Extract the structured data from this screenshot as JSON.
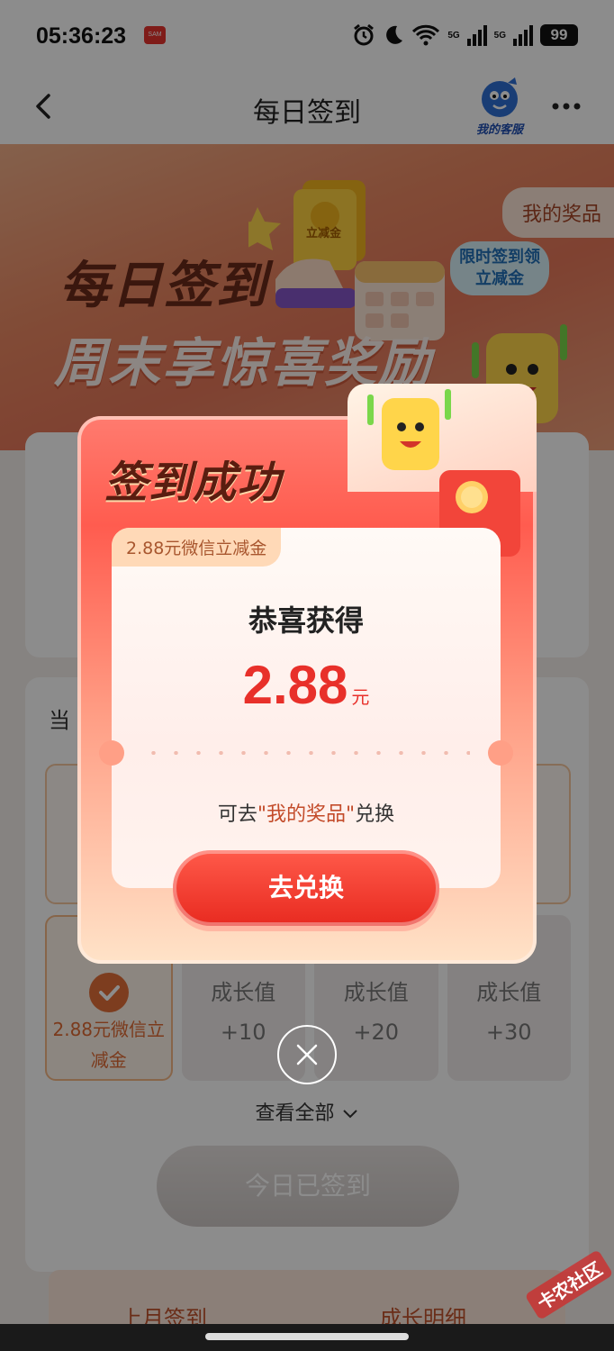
{
  "status_bar": {
    "time": "05:36:23",
    "app_icon_text": "SAM",
    "signal_1_label": "5G",
    "signal_2_label": "5G",
    "battery": "99"
  },
  "nav": {
    "title": "每日签到",
    "service_label": "我的客服"
  },
  "hero": {
    "title_line1": "每日签到",
    "title_line2": "周末享惊喜奖励",
    "prize_tab": "我的奖品",
    "limit_badge": "限时签到领立减金",
    "coin_label": "立减金"
  },
  "background": {
    "card2_title": "当",
    "rewards": [
      {
        "title": "2.88元微信立减金",
        "checked": true
      },
      {
        "title": "成长值",
        "value": "+10"
      },
      {
        "title": "成长值",
        "value": "+20"
      },
      {
        "title": "成长值",
        "value": "+30"
      }
    ],
    "view_all": "查看全部",
    "signed_button": "今日已签到",
    "tab_last_month": "上月签到",
    "tab_growth": "成长明细"
  },
  "modal": {
    "success_title": "签到成功",
    "coupon_tag": "2.88元微信立减金",
    "congrats": "恭喜获得",
    "amount": "2.88",
    "unit": "元",
    "hint_prefix": "可去",
    "hint_highlight": "\"我的奖品\"",
    "hint_suffix": "兑换",
    "redeem_button": "去兑换"
  },
  "watermark": "卡农社区",
  "colors": {
    "accent_red": "#e8302a",
    "modal_top": "#ff5c4f",
    "reward_orange": "#e06b33"
  }
}
